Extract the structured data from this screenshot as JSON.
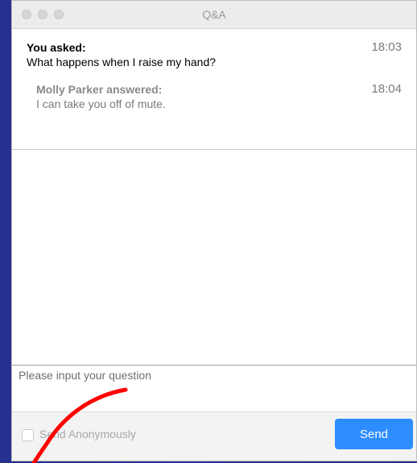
{
  "window": {
    "title": "Q&A"
  },
  "messages": [
    {
      "author": "You asked:",
      "text": "What happens when I raise my hand?",
      "time": "18:03"
    },
    {
      "author": "Molly Parker answered:",
      "text": "I can take you off of mute.",
      "time": "18:04"
    }
  ],
  "input": {
    "placeholder": "Please input your question",
    "value": ""
  },
  "footer": {
    "anonymous_label": "Send Anonymously",
    "anonymous_checked": false,
    "send_label": "Send"
  },
  "colors": {
    "send_button": "#2d8cff",
    "desktop": "#2a2f8f",
    "annotation_stroke": "#ff0000"
  },
  "icons": {
    "window_controls": [
      "close-icon",
      "minimize-icon",
      "zoom-icon"
    ]
  }
}
